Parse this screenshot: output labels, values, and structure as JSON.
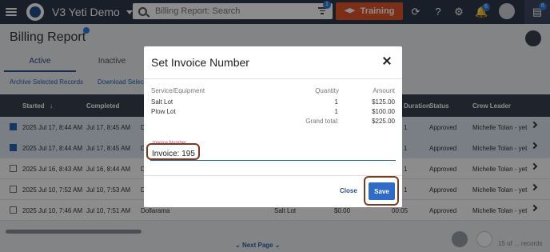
{
  "app": {
    "title": "V3 Yeti Demo",
    "search_placeholder": "Billing Report: Search",
    "search_badge": "1",
    "training_label": "Training",
    "notifications_count": "6",
    "chat_count": "6"
  },
  "page": {
    "title": "Billing Report",
    "tabs": [
      {
        "label": "Active"
      },
      {
        "label": "Inactive"
      }
    ],
    "actions": [
      {
        "label": "Archive Selected Records"
      },
      {
        "label": "Download Select"
      }
    ]
  },
  "table": {
    "headers": {
      "started": "Started",
      "completed": "Completed",
      "duration": "Duration",
      "status": "Status",
      "crew_leader": "Crew Leader"
    },
    "rows": [
      {
        "selected": true,
        "started": "2025 Jul 17, 8:44 AM",
        "completed": "Jul 17, 8:45 AM",
        "col_d": "D",
        "duration": "1",
        "status": "Approved",
        "crew": "Michelle Tolan - yet"
      },
      {
        "selected": true,
        "started": "2025 Jul 17, 8:44 AM",
        "completed": "Jul 17, 8:45 AM",
        "col_d": "D",
        "duration": "1",
        "status": "Approved",
        "crew": "Michelle Tolan - yet"
      },
      {
        "selected": false,
        "started": "2025 Jul 16, 8:43 AM",
        "completed": "Jul 16, 8:44 AM",
        "col_d": "D",
        "duration": "1",
        "status": "Approved",
        "crew": "Michelle Tolan - yet"
      },
      {
        "selected": false,
        "started": "2025 Jul 10, 7:52 AM",
        "completed": "Jul 10, 7:53 AM",
        "col_d": "D",
        "duration": "1",
        "status": "Approved",
        "crew": "Michelle Tolan - yet"
      },
      {
        "selected": false,
        "started": "2025 Jul 10, 7:46 AM",
        "completed": "Jul 10, 7:51 AM",
        "col_d": "Dollarama",
        "service": "Salt Lot",
        "amount": "$0.00",
        "duration": "00:05",
        "status": "Approved",
        "crew": "Michelle Tolan - yet"
      }
    ]
  },
  "footer": {
    "next_page": "Next Page",
    "records": "15 of ... records"
  },
  "modal": {
    "title": "Set Invoice Number",
    "col_service": "Service/Equipment",
    "col_quantity": "Quantity",
    "col_amount": "Amount",
    "items": [
      {
        "service": "Salt Lot",
        "quantity": "1",
        "amount": "$125.00"
      },
      {
        "service": "Plow Lot",
        "quantity": "1",
        "amount": "$100.00"
      }
    ],
    "grand_total_label": "Grand total:",
    "grand_total_value": "$225.00",
    "invoice_label": "Invoice Number",
    "invoice_value": "Invoice: 195",
    "close_label": "Close",
    "save_label": "Save"
  },
  "colors": {
    "topbar": "#2f3a4a",
    "training": "#e2552a",
    "accent": "#2f6cc9",
    "highlight": "#7a3b1e"
  }
}
